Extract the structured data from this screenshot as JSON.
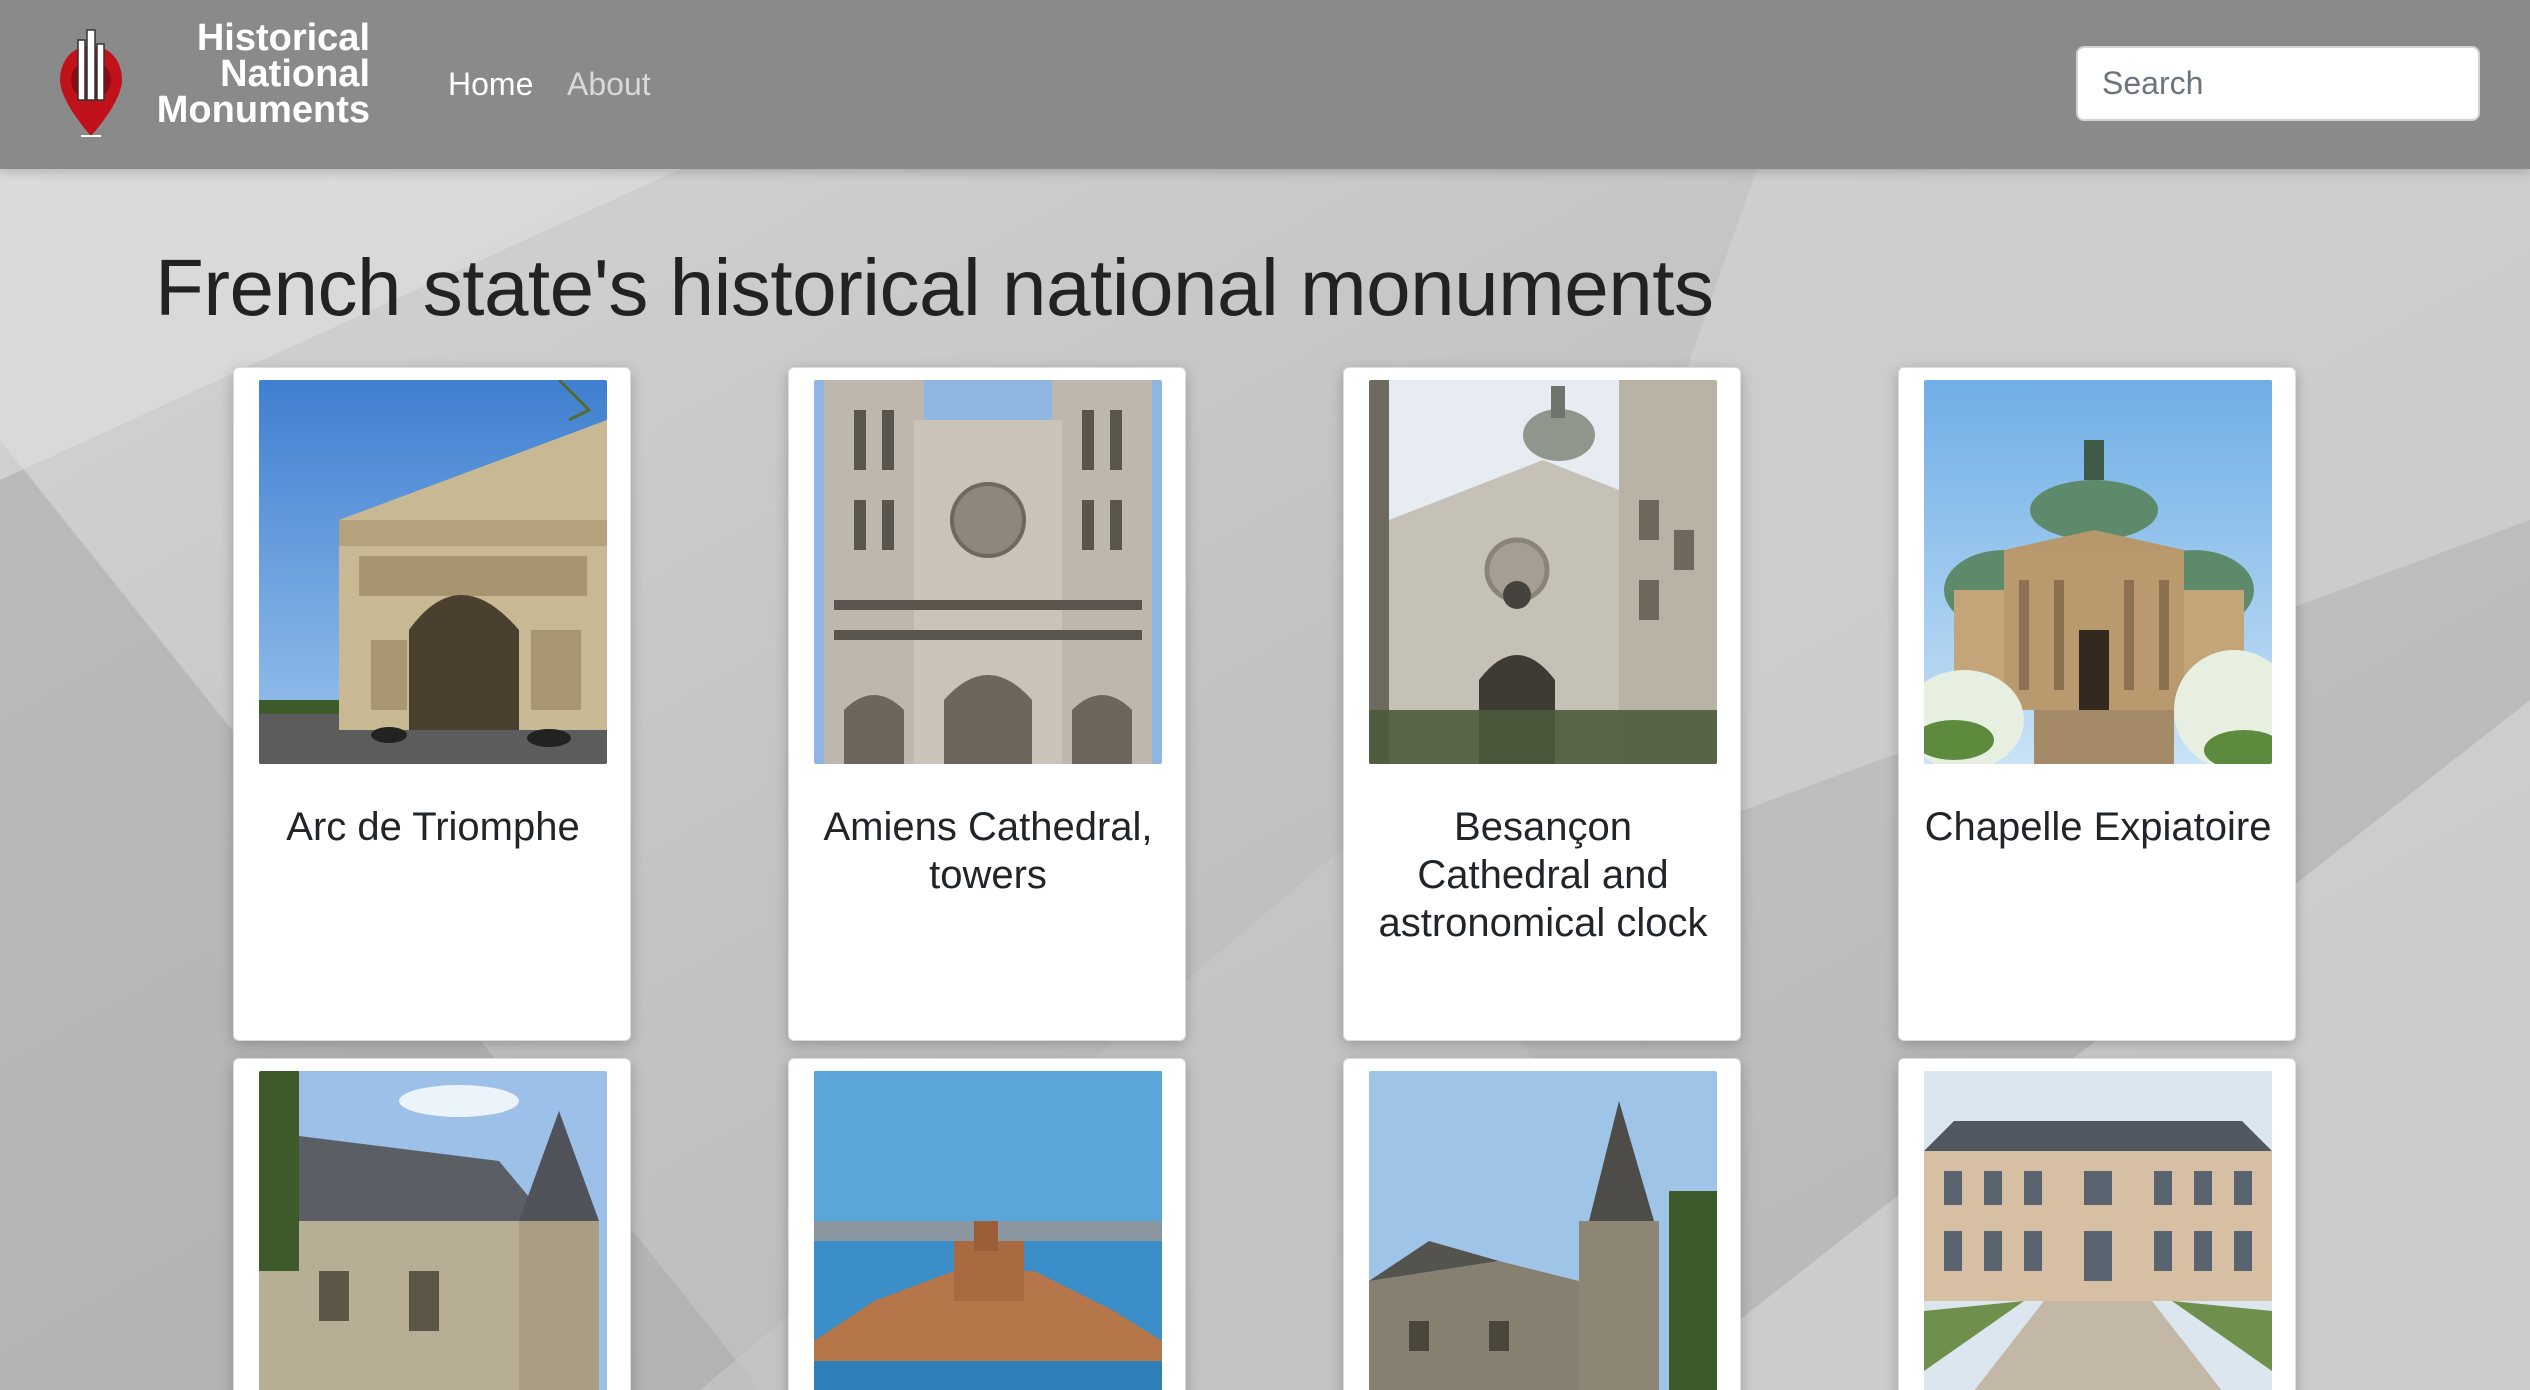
{
  "navbar": {
    "brand_lines": [
      "Historical",
      "National",
      "Monuments"
    ],
    "links": [
      {
        "label": "Home",
        "active": true
      },
      {
        "label": "About",
        "active": false
      }
    ],
    "search_placeholder": "Search",
    "logo_icon": "map-pin-with-buildings",
    "logo_color": "#c0121b"
  },
  "main": {
    "title": "French state's historical national monuments",
    "cards": [
      {
        "title": "Arc de Triomphe",
        "image": "arc-de-triomphe-photo"
      },
      {
        "title": "Amiens Cathedral, towers",
        "image": "amiens-cathedral-photo"
      },
      {
        "title": "Besançon Cathedral and astronomical clock",
        "image": "besancon-cathedral-photo"
      },
      {
        "title": "Chapelle Expiatoire",
        "image": "chapelle-expiatoire-photo"
      },
      {
        "title": "",
        "image": "stone-chateau-photo"
      },
      {
        "title": "",
        "image": "chateau-d-if-island-photo"
      },
      {
        "title": "",
        "image": "castle-round-tower-photo"
      },
      {
        "title": "",
        "image": "palace-courtyard-photo"
      }
    ]
  },
  "colors": {
    "navbar_bg": "#8a8a8a",
    "page_bg": "#bdbdbd",
    "heading": "#222222",
    "nav_inactive": "#d9d9d9"
  }
}
